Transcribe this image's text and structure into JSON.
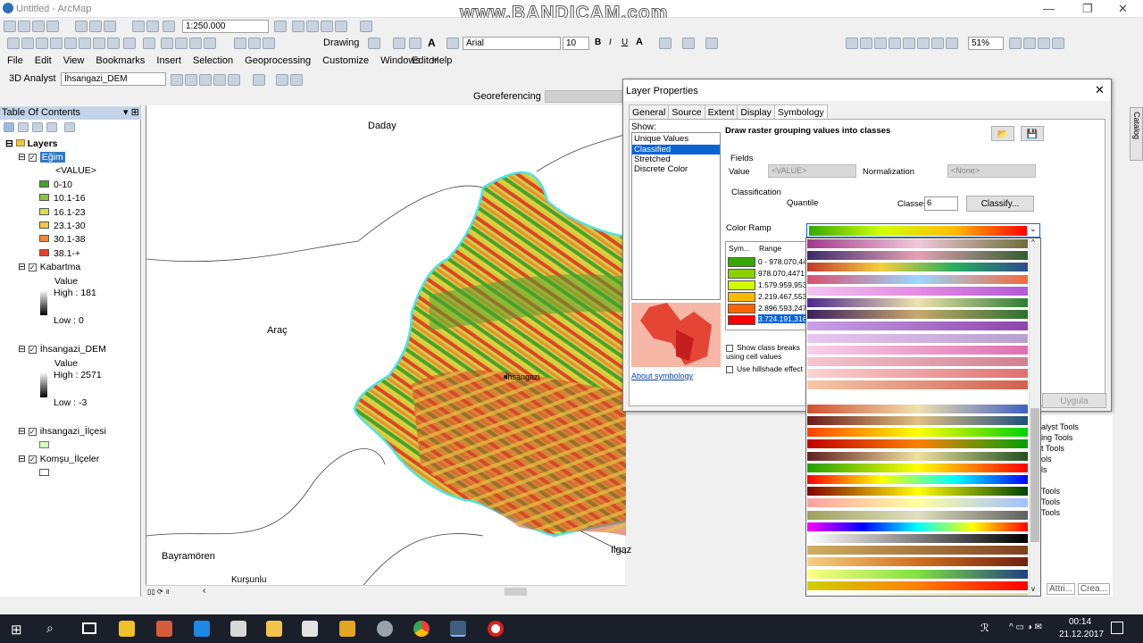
{
  "app_title": "Untitled - ArcMap",
  "watermark": "www.BANDICAM.com",
  "toolbar": {
    "scale": "1:250.000",
    "drawing": "Drawing",
    "font": "Arial",
    "size": "10",
    "zoom_pct": "51%"
  },
  "menu": [
    "File",
    "Edit",
    "View",
    "Bookmarks",
    "Insert",
    "Selection",
    "Geoprocessing",
    "Customize",
    "Windows",
    "Help"
  ],
  "editor": "Editor",
  "analyst": "3D Analyst",
  "dem_layer": "İhsangazi_DEM",
  "georef": "Georeferencing",
  "toc": {
    "title": "Table Of Contents",
    "layers": "Layers",
    "egim": {
      "name": "Eğim",
      "field": "<VALUE>",
      "classes": [
        {
          "label": "0-10",
          "color": "#4aa02c"
        },
        {
          "label": "10.1-16",
          "color": "#8cc63f"
        },
        {
          "label": "16.1-23",
          "color": "#d4e04a"
        },
        {
          "label": "23.1-30",
          "color": "#f2c744"
        },
        {
          "label": "30.1-38",
          "color": "#ef8a3c"
        },
        {
          "label": "38.1-+",
          "color": "#e5402a"
        }
      ]
    },
    "kabartma": {
      "name": "Kabartma",
      "value": "Value",
      "high": "High : 181",
      "low": "Low : 0"
    },
    "dem": {
      "name": "İhsangazi_DEM",
      "value": "Value",
      "high": "High : 2571",
      "low": "Low : -3"
    },
    "ilce": {
      "name": "ihsangazi_İlçesi"
    },
    "komsu": {
      "name": "Komşu_İlçeler"
    }
  },
  "map_labels": {
    "daday": "Daday",
    "arac": "Araç",
    "ihsangazi": "İhsangazi",
    "bayramoren": "Bayramören",
    "ilgaz": "Ilgaz",
    "kursunlu": "Kurşunlu"
  },
  "dialog": {
    "title": "Layer Properties",
    "tabs": [
      "General",
      "Source",
      "Extent",
      "Display",
      "Symbology"
    ],
    "show": "Show:",
    "show_items": [
      "Unique Values",
      "Classified",
      "Stretched",
      "Discrete Color"
    ],
    "heading": "Draw raster grouping values into classes",
    "fields": "Fields",
    "value_label": "Value",
    "value_field": "<VALUE>",
    "normalization": "Normalization",
    "norm_value": "<None>",
    "classification": "Classification",
    "method": "Quantile",
    "classes_label": "Classes",
    "classes_count": "6",
    "classify": "Classify...",
    "color_ramp": "Color Ramp",
    "col_sym": "Sym...",
    "col_range": "Range",
    "ranges": [
      {
        "label": "0 - 978.070,44",
        "color": "#38a800"
      },
      {
        "label": "978.070,4471",
        "color": "#8bd100"
      },
      {
        "label": "1.579.959,953",
        "color": "#d1ff00"
      },
      {
        "label": "2.219.467,553",
        "color": "#ffbb00"
      },
      {
        "label": "2.896.593,247",
        "color": "#ff6600"
      },
      {
        "label": "3.724.191,316",
        "color": "#ff0000"
      }
    ],
    "show_breaks": "Show class breaks using cell values",
    "hillshade": "Use hillshade effect",
    "about": "About symbology",
    "apply": "Uygula"
  },
  "side_tools": [
    "alyst Tools",
    "ing Tools",
    "t Tools",
    "ols",
    "ls",
    "Tools",
    "Tools",
    "Tools"
  ],
  "catalog": "Catalog",
  "bottom_tabs": [
    "Attri...",
    "Crea..."
  ],
  "taskbar": {
    "time": "00:14",
    "date": "21.12.2017"
  }
}
